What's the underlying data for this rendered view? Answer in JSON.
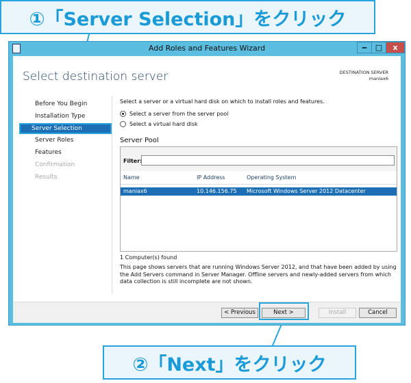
{
  "callouts": {
    "step1": "①「Server Selection」をクリック",
    "step2": "②「Next」をクリック"
  },
  "window": {
    "title": "Add Roles and Features Wizard",
    "minimize": "‒",
    "maximize": "□",
    "close": "x"
  },
  "page": {
    "heading": "Select destination server",
    "destination_label": "DESTINATION SERVER",
    "destination_value": "maniax6"
  },
  "sidebar": {
    "items": [
      {
        "label": "Before You Begin",
        "enabled": true
      },
      {
        "label": "Installation Type",
        "enabled": true
      },
      {
        "label": "Server Selection",
        "enabled": true,
        "selected": true
      },
      {
        "label": "Server Roles",
        "enabled": true
      },
      {
        "label": "Features",
        "enabled": true
      },
      {
        "label": "Confirmation",
        "enabled": false
      },
      {
        "label": "Results",
        "enabled": false
      }
    ]
  },
  "main": {
    "intro": "Select a server or a virtual hard disk on which to install roles and features.",
    "radio_pool": "Select a server from the server pool",
    "radio_vhd": "Select a virtual hard disk",
    "selected_radio": "pool",
    "pool_title": "Server Pool",
    "filter_label": "Filter:",
    "filter_value": "",
    "columns": [
      "Name",
      "IP Address",
      "Operating System"
    ],
    "rows": [
      {
        "name": "maniax6",
        "ip": "10.146.156.75",
        "os": "Microsoft Windows Server 2012 Datacenter",
        "selected": true
      }
    ],
    "count": "1 Computer(s) found",
    "note": "This page shows servers that are running Windows Server 2012, and that have been added by using the Add Servers command in Server Manager. Offline servers and newly-added servers from which data collection is still incomplete are not shown."
  },
  "buttons": {
    "previous": "< Previous",
    "next": "Next >",
    "install": "Install",
    "cancel": "Cancel"
  },
  "colors": {
    "accent": "#29a3dd",
    "selection": "#1c6fb5",
    "titlebar": "#5bbde0"
  }
}
